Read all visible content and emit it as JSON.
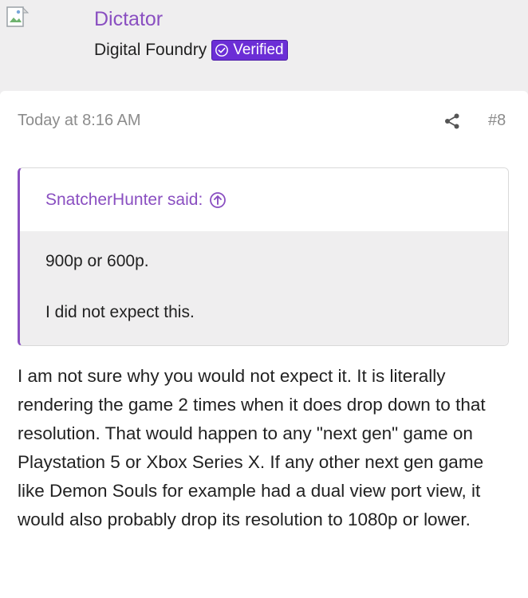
{
  "user": {
    "name": "Dictator",
    "title": "Digital Foundry",
    "badge": "Verified",
    "colors": {
      "name": "#8a4fc1",
      "badge_bg": "#6b2ed6"
    }
  },
  "post": {
    "timestamp": "Today at 8:16 AM",
    "number": "#8",
    "share_icon": "share-icon",
    "quote": {
      "author_label": "SnatcherHunter said:",
      "jump_icon": "arrow-up-circle-icon",
      "lines": [
        "900p or 600p.",
        "I did not expect this."
      ]
    },
    "body": "I am not sure why you would not expect it. It is literally rendering the game 2 times when it does drop down to that resolution. That would happen to any \"next gen\" game on Playstation 5 or Xbox Series X. If any other next gen game like Demon Souls for example had a dual view port view, it would also probably drop its resolution to 1080p or lower."
  }
}
